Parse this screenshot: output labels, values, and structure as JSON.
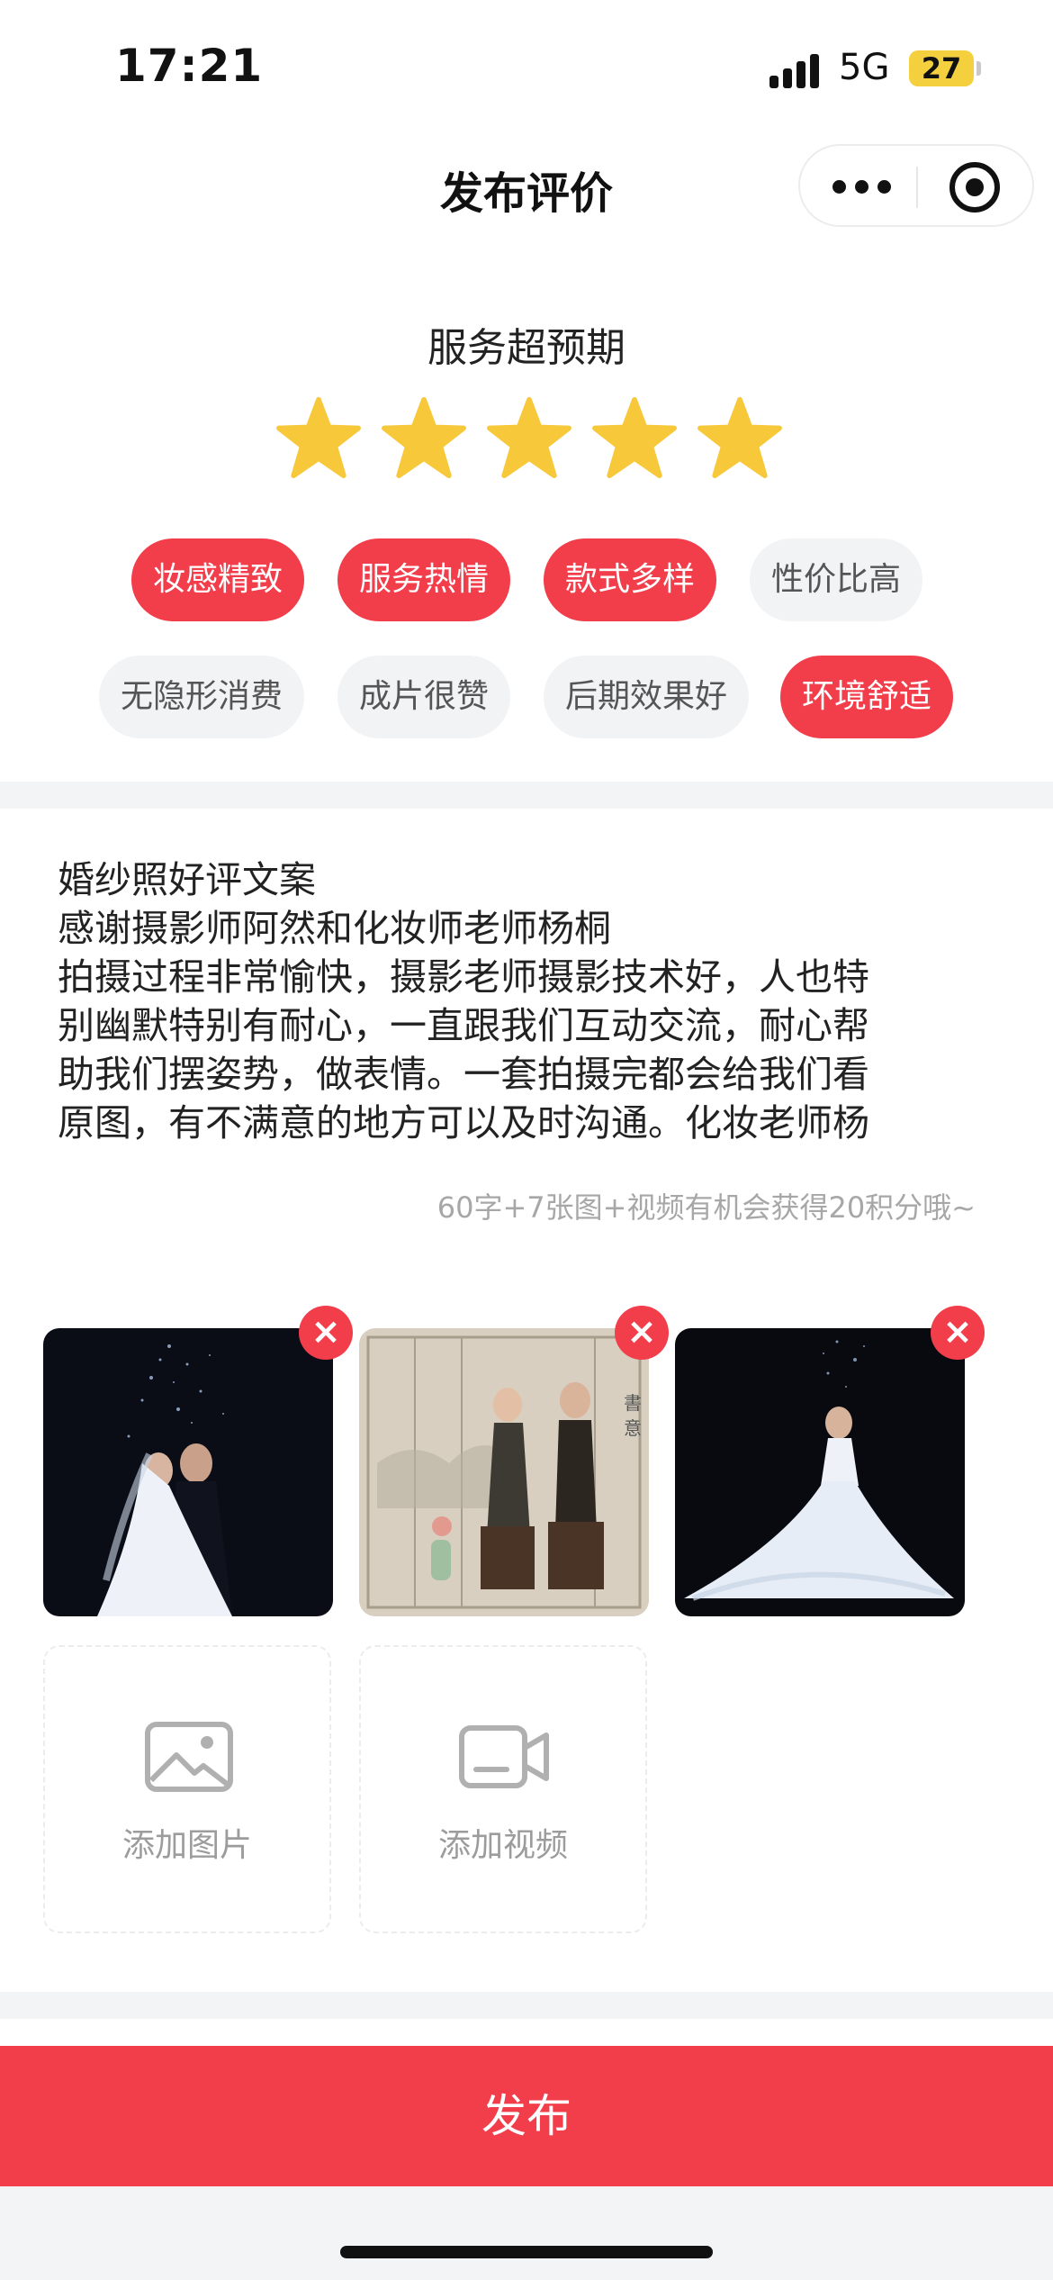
{
  "status_bar": {
    "time": "17:21",
    "network": "5G",
    "battery": "27"
  },
  "header": {
    "title": "发布评价",
    "more_icon": "more-dots-icon",
    "close_icon": "target-icon"
  },
  "rating": {
    "label": "服务超预期",
    "stars": 5,
    "max_stars": 5,
    "star_color": "#f7c83a"
  },
  "tags": [
    {
      "label": "妆感精致",
      "selected": true
    },
    {
      "label": "服务热情",
      "selected": true
    },
    {
      "label": "款式多样",
      "selected": true
    },
    {
      "label": "性价比高",
      "selected": false
    },
    {
      "label": "无隐形消费",
      "selected": false
    },
    {
      "label": "成片很赞",
      "selected": false
    },
    {
      "label": "后期效果好",
      "selected": false
    },
    {
      "label": "环境舒适",
      "selected": true
    }
  ],
  "review": {
    "lines": [
      "婚纱照好评文案",
      "感谢摄影师阿然和化妆师老师杨桐",
      "拍摄过程非常愉快，摄影老师摄影技术好，人也特",
      "别幽默特别有耐心，一直跟我们互动交流，耐心帮",
      "助我们摆姿势，做表情。一套拍摄完都会给我们看",
      "原图，有不满意的地方可以及时沟通。化妆老师杨"
    ],
    "hint": "60字+7张图+视频有机会获得20积分哦~"
  },
  "media": {
    "photos": [
      {
        "name": "wedding-photo-couple",
        "remove_icon": "close-icon"
      },
      {
        "name": "qipao-photo-seated",
        "remove_icon": "close-icon",
        "overlay_text": "書 意"
      },
      {
        "name": "wedding-photo-gown",
        "remove_icon": "close-icon"
      }
    ],
    "add_photo_label": "添加图片",
    "add_video_label": "添加视频"
  },
  "footer": {
    "publish_label": "发布"
  },
  "colors": {
    "accent": "#f23d4a",
    "tag_inactive_bg": "#f2f3f5",
    "separator": "#f3f4f6"
  }
}
